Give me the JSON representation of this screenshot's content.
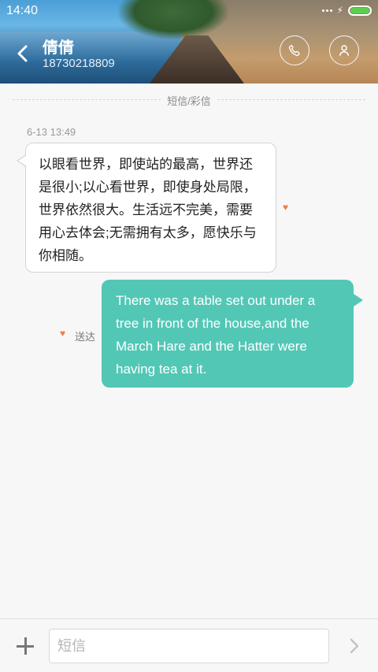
{
  "status": {
    "time": "14:40"
  },
  "header": {
    "contact_name": "倩倩",
    "contact_number": "18730218809"
  },
  "thread": {
    "divider_label": "短信/彩信",
    "timestamp": "6-13 13:49",
    "incoming_message": "以眼看世界，即使站的最高，世界还是很小;以心看世界，即使身处局限，世界依然很大。生活远不完美，需要用心去体会;无需拥有太多，愿快乐与你相随。",
    "outgoing_message": "There was a table set out under a tree in front of the house,and the March Hare and the Hatter were having tea at it.",
    "delivered_label": "送达"
  },
  "composer": {
    "placeholder": "短信"
  },
  "colors": {
    "outgoing_bubble": "#53c7b6",
    "heart": "#f07c4c",
    "battery": "#5ad04a"
  },
  "icons": [
    "back-arrow-icon",
    "phone-icon",
    "person-icon",
    "heart-icon",
    "plus-icon",
    "send-arrow-icon"
  ]
}
